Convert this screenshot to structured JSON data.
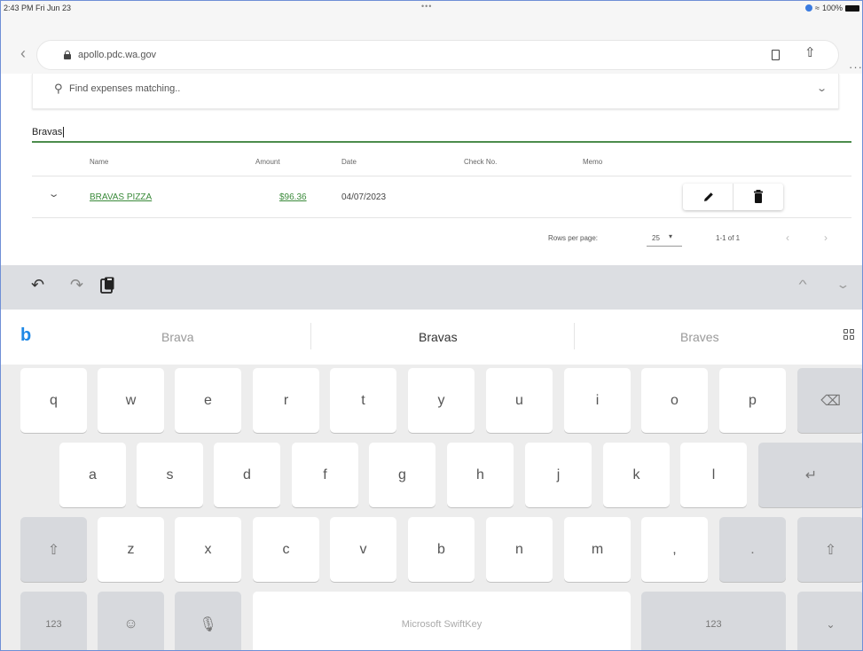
{
  "status_bar": {
    "time": "2:43 PM  Fri Jun 23",
    "dots": "•••",
    "battery_label": "100%"
  },
  "browser": {
    "url": "apollo.pdc.wa.gov",
    "back_icon": "‹",
    "more_icon": "···"
  },
  "filter": {
    "placeholder": "Find expenses matching..",
    "search_icon": "search-icon"
  },
  "search": {
    "value": "Bravas"
  },
  "table": {
    "columns": [
      "Name",
      "Amount",
      "Date",
      "Check No.",
      "Memo"
    ],
    "rows": [
      {
        "name": "BRAVAS PIZZA",
        "amount": "$96.36",
        "date": "04/07/2023",
        "check_no": "",
        "memo": ""
      }
    ]
  },
  "pagination": {
    "rows_per_page_label": "Rows per page:",
    "rows_per_page": "25",
    "range": "1-1 of 1"
  },
  "suggestions": [
    "Brava",
    "Bravas",
    "Braves"
  ],
  "keyboard": {
    "row1": [
      "q",
      "w",
      "e",
      "r",
      "t",
      "y",
      "u",
      "i",
      "o",
      "p"
    ],
    "row2": [
      "a",
      "s",
      "d",
      "f",
      "g",
      "h",
      "j",
      "k",
      "l"
    ],
    "row3": [
      "z",
      "x",
      "c",
      "v",
      "b",
      "n",
      "m",
      ","
    ],
    "num_left": "123",
    "num_right": "123",
    "space_label": "Microsoft SwiftKey"
  },
  "colors": {
    "accent_green": "#3a8a3a",
    "bing_blue": "#1e88e5",
    "underline_green": "#4c8c4c"
  }
}
